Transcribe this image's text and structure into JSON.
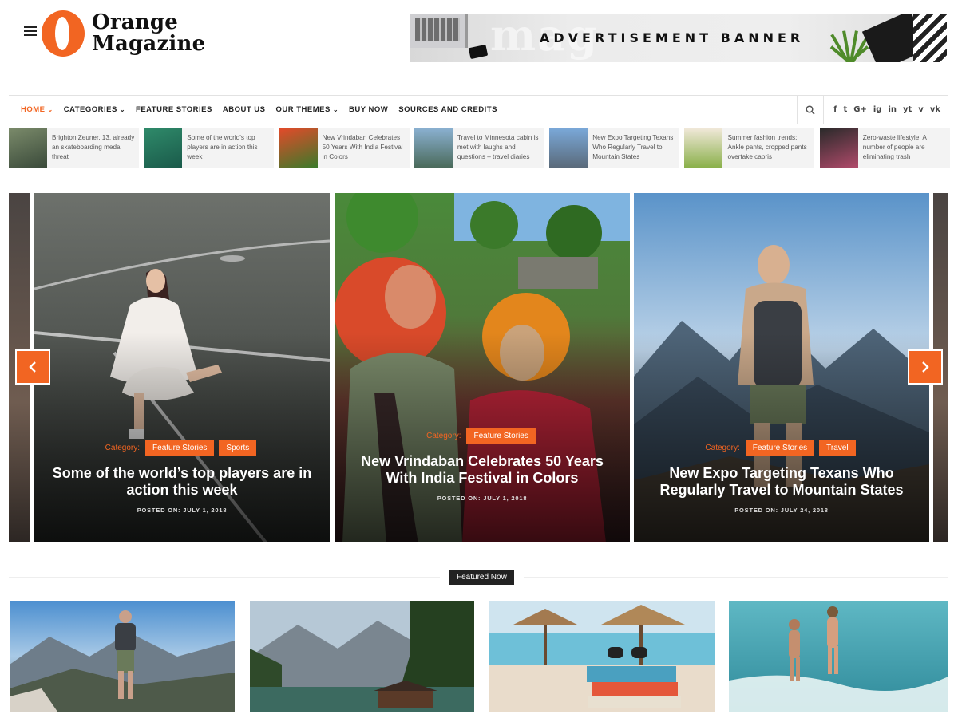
{
  "header": {
    "logo_line1": "Orange",
    "logo_line2": "Magazine",
    "ad_text": "ADVERTISEMENT BANNER",
    "ad_ghost": "mag"
  },
  "nav": {
    "items": [
      {
        "label": "HOME",
        "dropdown": true,
        "active": true
      },
      {
        "label": "CATEGORIES",
        "dropdown": true
      },
      {
        "label": "FEATURE STORIES"
      },
      {
        "label": "ABOUT US"
      },
      {
        "label": "OUR THEMES",
        "dropdown": true
      },
      {
        "label": "BUY NOW"
      },
      {
        "label": "SOURCES AND CREDITS"
      }
    ],
    "social": [
      "f",
      "t",
      "G+",
      "ig",
      "in",
      "yt",
      "v",
      "vk"
    ]
  },
  "ticker": [
    {
      "text": "Brighton Zeuner, 13, already an skateboarding medal threat"
    },
    {
      "text": "Some of the world's top players are in action this week"
    },
    {
      "text": "New Vrindaban Celebrates 50 Years With India Festival in Colors"
    },
    {
      "text": "Travel to Minnesota cabin is met with laughs and questions – travel diaries"
    },
    {
      "text": "New Expo Targeting Texans Who Regularly Travel to Mountain States"
    },
    {
      "text": "Summer fashion trends: Ankle pants, cropped pants overtake capris"
    },
    {
      "text": "Zero-waste lifestyle: A number of people are eliminating trash"
    }
  ],
  "slides": [
    {
      "category_label": "Category:",
      "categories": [
        "Feature Stories",
        "Sports"
      ],
      "title": "Some of the world’s top players are in action this week",
      "date": "POSTED ON: JULY 1, 2018"
    },
    {
      "category_label": "Category:",
      "categories": [
        "Feature Stories"
      ],
      "title": "New Vrindaban Celebrates 50 Years With India Festival in Colors",
      "date": "POSTED ON: JULY 1, 2018"
    },
    {
      "category_label": "Category:",
      "categories": [
        "Feature Stories",
        "Travel"
      ],
      "title": "New Expo Targeting Texans Who Regularly Travel to Mountain States",
      "date": "POSTED ON: JULY 24, 2018"
    }
  ],
  "featured": {
    "label": "Featured Now"
  },
  "colors": {
    "accent": "#f26522",
    "dark": "#222222"
  }
}
